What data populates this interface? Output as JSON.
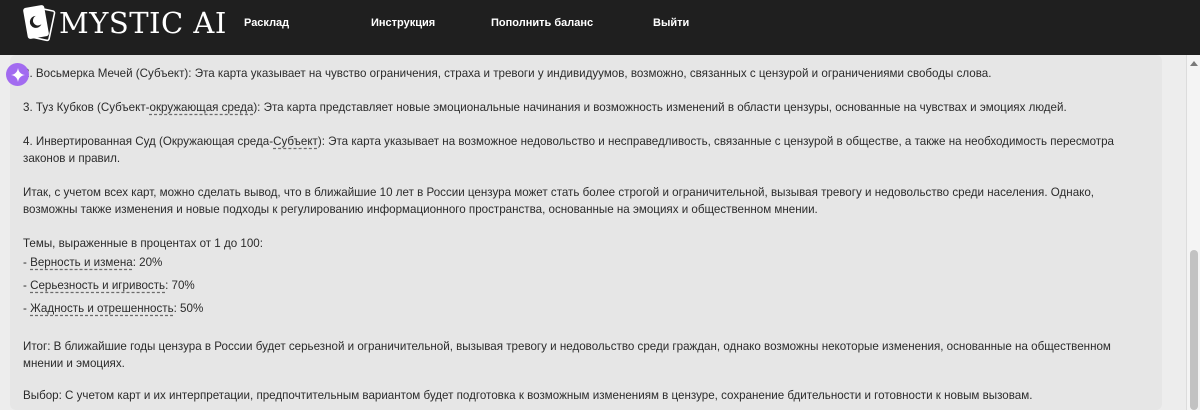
{
  "header": {
    "logo_text": "MYSTIC AI",
    "logo_icon": "moon-card-icon",
    "nav": [
      {
        "label": "Расклад"
      },
      {
        "label": "Инструкция"
      },
      {
        "label": "Пополнить баланс"
      },
      {
        "label": "Выйти"
      }
    ],
    "background": "#1f1f1f"
  },
  "assistant": {
    "icon": "sparkle-icon",
    "accent": "#a26bf0"
  },
  "message": {
    "p1": {
      "text": "2. Восьмерка Мечей (Субъект): Эта карта указывает на чувство ограничения, страха и тревоги у индивидуумов, возможно, связанных с цензурой и ограничениями свободы слова."
    },
    "p2": {
      "a": "3. Туз Кубков (Субъект-",
      "u": "окружающая среда",
      "b": "): Эта карта представляет новые эмоциональные начинания и возможность изменений в области цензуры, основанные на чувствах и эмоциях людей."
    },
    "p3": {
      "a": "4. Инвертированная Суд (Окружающая среда-",
      "u": "Субъект",
      "b": "): Эта карта указывает на возможное недовольство и несправедливость, связанные с цензурой в обществе, а также на необходимость пересмотра законов и правил."
    },
    "p4": {
      "text": "Итак, с учетом всех карт, можно сделать вывод, что в ближайшие 10 лет в России цензура может стать более строгой и ограничительной, вызывая тревогу и недовольство среди населения. Однако, возможны также изменения и новые подходы к регулированию информационного пространства, основанные на эмоциях и общественном мнении."
    },
    "themes": {
      "heading": "Темы, выраженные в процентах от 1 до 100:",
      "items": [
        {
          "prefix": "- ",
          "name": "Верность и измена",
          "value": ": 20%"
        },
        {
          "prefix": "- ",
          "name": "Серьезность и игривость",
          "value": ": 70%"
        },
        {
          "prefix": "- ",
          "name": "Жадность и отрешенность",
          "value": ": 50%"
        }
      ]
    },
    "p5": {
      "text": "Итог: В ближайшие годы цензура в России будет серьезной и ограничительной, вызывая тревогу и недовольство среди граждан, однако возможны некоторые изменения, основанные на общественном мнении и эмоциях."
    },
    "p6": {
      "text": "Выбор: С учетом карт и их интерпретации, предпочтительным вариантом будет подготовка к возможным изменениям в цензуре, сохранение бдительности и готовности к новым вызовам."
    }
  }
}
